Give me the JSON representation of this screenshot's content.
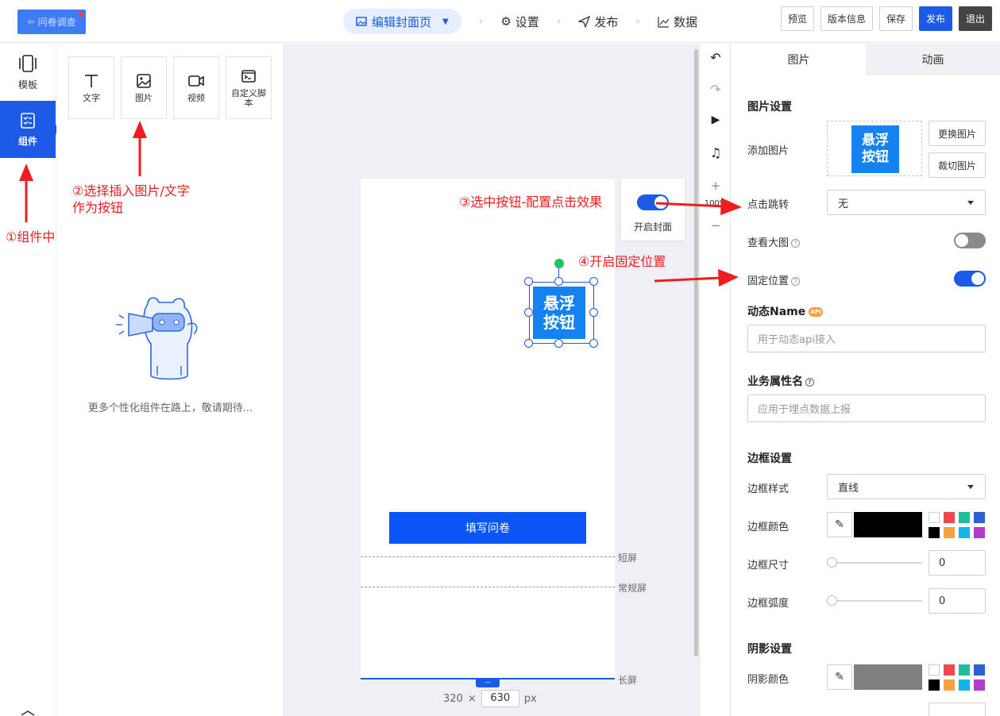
{
  "topbar": {
    "app_label": "问卷调查",
    "steps": [
      {
        "label": "编辑封面页"
      },
      {
        "label": "设置"
      },
      {
        "label": "发布"
      },
      {
        "label": "数据"
      }
    ],
    "actions": {
      "preview": "预览",
      "version": "版本信息",
      "save": "保存",
      "publish": "发布",
      "exit": "退出"
    }
  },
  "rail": {
    "items": [
      {
        "label": "模板"
      },
      {
        "label": "组件"
      }
    ]
  },
  "components": {
    "tiles": [
      {
        "label": "文字",
        "icon": "text-icon"
      },
      {
        "label": "图片",
        "icon": "image-icon"
      },
      {
        "label": "视频",
        "icon": "video-icon"
      },
      {
        "label": "自定义脚本",
        "icon": "script-icon"
      }
    ],
    "hint": "更多个性化组件在路上，敬请期待..."
  },
  "canvas": {
    "cover_toggle_label": "开启封面",
    "float_button_text": "悬浮按钮",
    "fill_button": "填写问卷",
    "guides": [
      "短屏",
      "常规屏",
      "长屏"
    ],
    "width": "320",
    "times": "×",
    "height": "630",
    "unit": "px",
    "zoom": "100%"
  },
  "props": {
    "tabs": [
      "图片",
      "动画"
    ],
    "image_settings": "图片设置",
    "add_image": "添加图片",
    "replace_image": "更换图片",
    "crop_image": "裁切图片",
    "click_jump": "点击跳转",
    "click_jump_value": "无",
    "view_large": "查看大图",
    "fixed_position": "固定位置",
    "dynamic_name": "动态Name",
    "api_badge": "API",
    "dynamic_placeholder": "用于动态api接入",
    "biz_attr": "业务属性名",
    "biz_placeholder": "应用于埋点数据上报",
    "border_settings": "边框设置",
    "border_style": "边框样式",
    "border_style_value": "直线",
    "border_color": "边框颜色",
    "border_size": "边框尺寸",
    "border_size_value": "0",
    "border_radius": "边框弧度",
    "border_radius_value": "0",
    "shadow_settings": "阴影设置",
    "shadow_color": "阴影颜色",
    "swatches": [
      "#ffffff",
      "#f04848",
      "#1dbf9a",
      "#2c5fd1",
      "#000000",
      "#f5a340",
      "#13b5e8",
      "#b43bc9"
    ],
    "border_color_hex": "#000000",
    "shadow_color_hex": "#808080"
  },
  "annotations": {
    "a1": "①组件中",
    "a2_line1": "②选择插入图片/文字",
    "a2_line2": "作为按钮",
    "a3": "③选中按钮-配置点击效果",
    "a4": "④开启固定位置"
  }
}
